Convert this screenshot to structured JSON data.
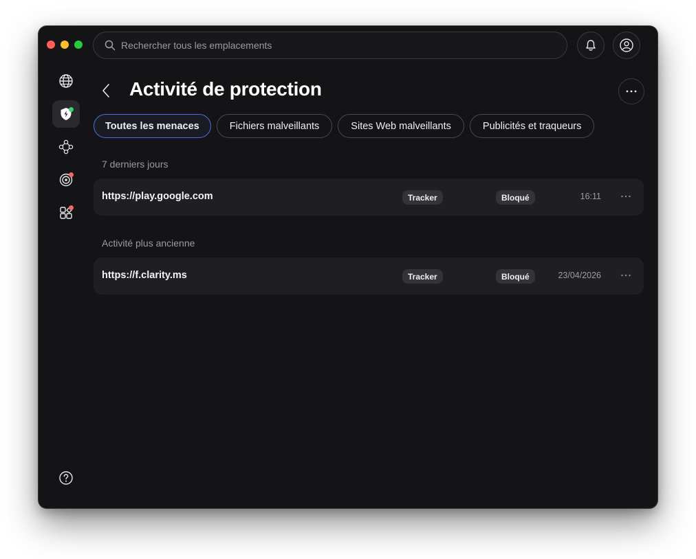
{
  "search": {
    "placeholder": "Rechercher tous les emplacements"
  },
  "page": {
    "title": "Activité de protection"
  },
  "tabs": [
    {
      "label": "Toutes les menaces",
      "active": true
    },
    {
      "label": "Fichiers malveillants",
      "active": false
    },
    {
      "label": "Sites Web malveillants",
      "active": false
    },
    {
      "label": "Publicités et traqueurs",
      "active": false
    }
  ],
  "sections": [
    {
      "label": "7 derniers jours",
      "rows": [
        {
          "url": "https://play.google.com",
          "type": "Tracker",
          "status": "Bloqué",
          "time": "16:11"
        }
      ]
    },
    {
      "label": "Activité plus ancienne",
      "rows": [
        {
          "url": "https://f.clarity.ms",
          "type": "Tracker",
          "status": "Bloqué",
          "time": "23/04/2026"
        }
      ]
    }
  ],
  "sidebar": {
    "items": [
      {
        "icon": "globe-icon",
        "active": false,
        "badge": null
      },
      {
        "icon": "shield-icon",
        "active": true,
        "badge": "#3ecf6e"
      },
      {
        "icon": "network-icon",
        "active": false,
        "badge": null
      },
      {
        "icon": "target-icon",
        "active": false,
        "badge": "#f06a6a"
      },
      {
        "icon": "apps-icon",
        "active": false,
        "badge": "#f06a6a"
      }
    ],
    "help_icon": "help-icon"
  },
  "colors": {
    "accent": "#4f6ee8",
    "background": "#141416",
    "row_background": "#1f1f22"
  }
}
